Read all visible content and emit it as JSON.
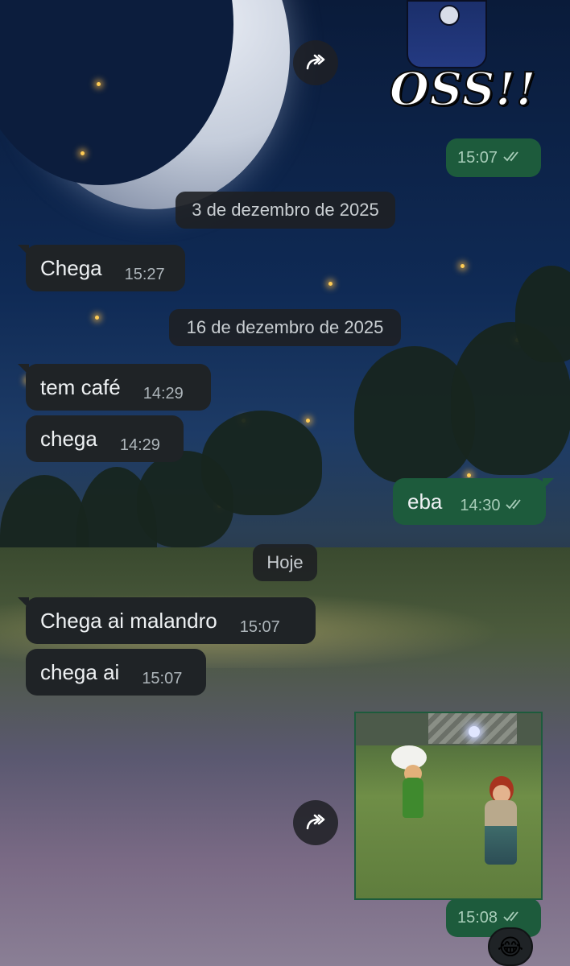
{
  "sticker": {
    "text": "OSS!!"
  },
  "messages": [
    {
      "dir": "out",
      "text": "",
      "time": "15:07",
      "status": "read"
    },
    {
      "dir": "in",
      "text": "Chega",
      "time": "15:27"
    },
    {
      "dir": "in",
      "text": "tem café",
      "time": "14:29"
    },
    {
      "dir": "in",
      "text": "chega",
      "time": "14:29"
    },
    {
      "dir": "out",
      "text": "eba",
      "time": "14:30",
      "status": "read"
    },
    {
      "dir": "in",
      "text": "Chega ai malandro",
      "time": "15:07"
    },
    {
      "dir": "in",
      "text": "chega ai",
      "time": "15:07"
    },
    {
      "dir": "out",
      "text": "",
      "time": "15:08",
      "status": "read"
    }
  ],
  "date_separators": [
    "3 de dezembro de 2025",
    "16 de dezembro de 2025",
    "Hoje"
  ],
  "reaction": {
    "emoji": "😂"
  },
  "icons": {
    "forward": "forward-icon",
    "read_receipt": "double-check-icon"
  },
  "colors": {
    "incoming_bubble": "#1f2326",
    "outgoing_bubble": "#1d5b3c",
    "read_ticks": "#a8cdb9"
  }
}
